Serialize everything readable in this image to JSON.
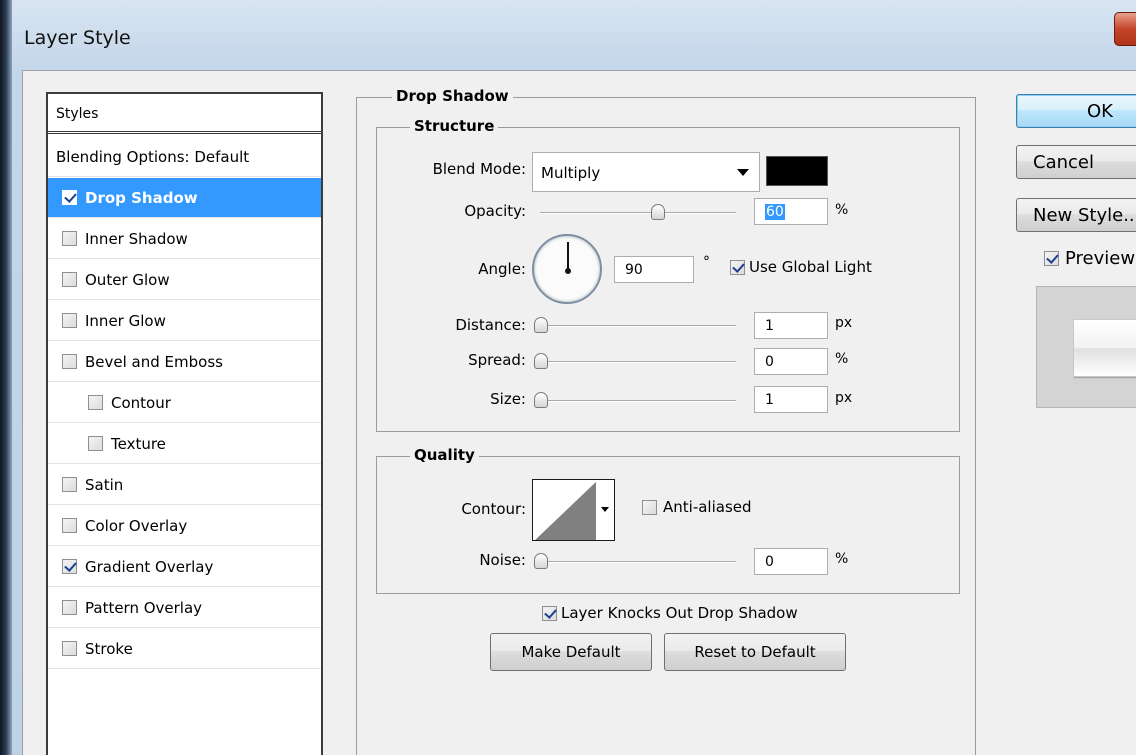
{
  "window": {
    "title": "Layer Style"
  },
  "styles_list": {
    "header": "Styles",
    "blending_options": "Blending Options: Default",
    "items": [
      {
        "label": "Drop Shadow",
        "checked": true,
        "selected": true,
        "indent": false
      },
      {
        "label": "Inner Shadow",
        "checked": false,
        "selected": false,
        "indent": false
      },
      {
        "label": "Outer Glow",
        "checked": false,
        "selected": false,
        "indent": false
      },
      {
        "label": "Inner Glow",
        "checked": false,
        "selected": false,
        "indent": false
      },
      {
        "label": "Bevel and Emboss",
        "checked": false,
        "selected": false,
        "indent": false
      },
      {
        "label": "Contour",
        "checked": false,
        "selected": false,
        "indent": true
      },
      {
        "label": "Texture",
        "checked": false,
        "selected": false,
        "indent": true
      },
      {
        "label": "Satin",
        "checked": false,
        "selected": false,
        "indent": false
      },
      {
        "label": "Color Overlay",
        "checked": false,
        "selected": false,
        "indent": false
      },
      {
        "label": "Gradient Overlay",
        "checked": true,
        "selected": false,
        "indent": false
      },
      {
        "label": "Pattern Overlay",
        "checked": false,
        "selected": false,
        "indent": false
      },
      {
        "label": "Stroke",
        "checked": false,
        "selected": false,
        "indent": false
      }
    ]
  },
  "drop_shadow": {
    "title": "Drop Shadow",
    "structure": {
      "title": "Structure",
      "blend_mode_label": "Blend Mode:",
      "blend_mode_value": "Multiply",
      "shadow_color": "#000000",
      "opacity_label": "Opacity:",
      "opacity_value": "60",
      "opacity_level": 0.6,
      "opacity_unit": "%",
      "angle_label": "Angle:",
      "angle_value": "90",
      "angle_unit": "°",
      "use_global_light_label": "Use Global Light",
      "use_global_light": true,
      "distance_label": "Distance:",
      "distance_value": "1",
      "distance_unit": "px",
      "spread_label": "Spread:",
      "spread_value": "0",
      "spread_unit": "%",
      "size_label": "Size:",
      "size_value": "1",
      "size_unit": "px"
    },
    "quality": {
      "title": "Quality",
      "contour_label": "Contour:",
      "anti_aliased_label": "Anti-aliased",
      "anti_aliased": false,
      "noise_label": "Noise:",
      "noise_value": "0",
      "noise_unit": "%"
    },
    "knocks_out_label": "Layer Knocks Out Drop Shadow",
    "knocks_out": true,
    "make_default_label": "Make Default",
    "reset_default_label": "Reset to Default"
  },
  "actions": {
    "ok_label": "OK",
    "cancel_label": "Cancel",
    "new_style_label": "New Style...",
    "preview_label": "Preview",
    "preview_checked": true
  },
  "icons": {
    "close": "close-icon",
    "dropdown": "chevron-down-icon"
  }
}
